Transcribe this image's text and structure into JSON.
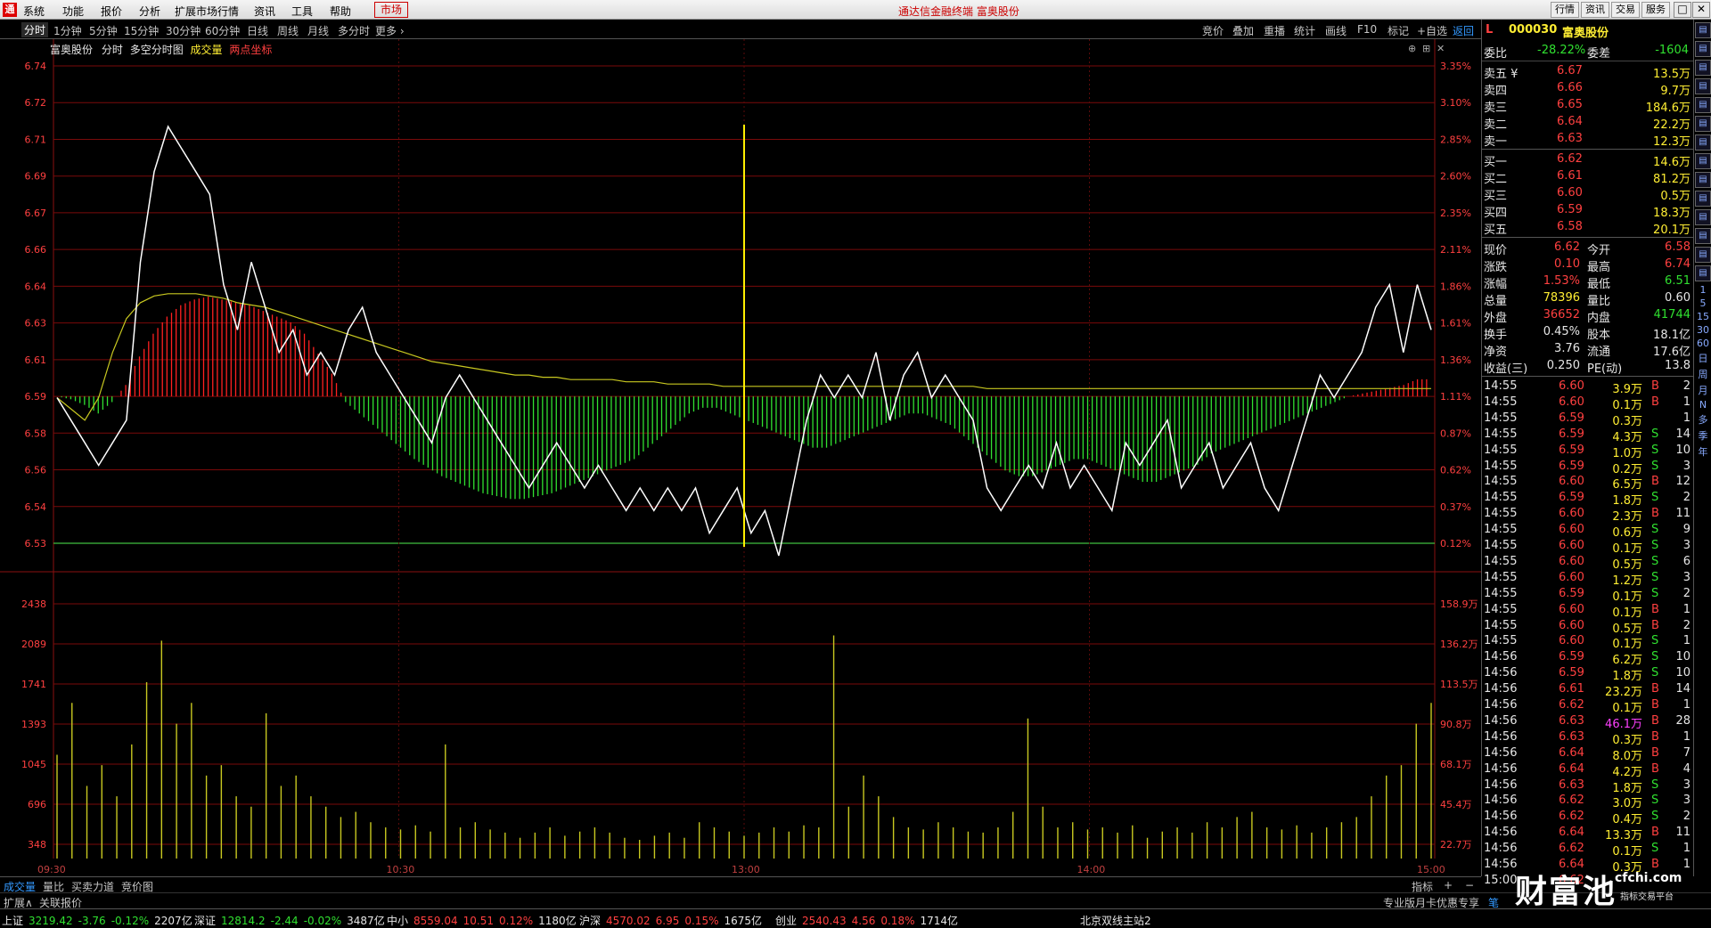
{
  "menubar": {
    "items": [
      "系统",
      "功能",
      "报价",
      "分析",
      "扩展市场行情",
      "资讯",
      "工具",
      "帮助"
    ],
    "market_label": "市场",
    "center_title": "通达信金融终端  富奥股份",
    "right_buttons": [
      "行情",
      "资讯",
      "交易",
      "服务"
    ],
    "win_buttons": [
      "─",
      "□",
      "✕"
    ]
  },
  "periods": {
    "items": [
      "分时",
      "1分钟",
      "5分钟",
      "15分钟",
      "30分钟",
      "60分钟",
      "日线",
      "周线",
      "月线",
      "多分时",
      "更多 ›"
    ],
    "active": "分时"
  },
  "toolbar": {
    "items": [
      "竞价",
      "叠加",
      "重播",
      "统计",
      "画线",
      "F10",
      "标记",
      "+自选"
    ],
    "back": "返回"
  },
  "chart_header": {
    "stock": "富奥股份",
    "items": [
      "分时",
      "多空分时图"
    ],
    "vol_label": "成交量",
    "two_point": "两点坐标"
  },
  "chart_data": {
    "type": "line",
    "price_axis": {
      "min": 6.52,
      "max": 6.74,
      "ticks": [
        6.74,
        6.72,
        6.71,
        6.69,
        6.67,
        6.66,
        6.64,
        6.63,
        6.61,
        6.59,
        6.58,
        6.56,
        6.54,
        6.53
      ],
      "labels": [
        "6.74",
        "6.72",
        "6.71",
        "6.69",
        "6.67",
        "6.66",
        "6.64",
        "6.63",
        "6.61",
        "6.59",
        "6.58",
        "6.56",
        "6.54",
        "6.53"
      ]
    },
    "pct_axis": {
      "labels": [
        "3.35%",
        "3.10%",
        "2.85%",
        "2.60%",
        "2.35%",
        "2.11%",
        "1.86%",
        "1.61%",
        "1.36%",
        "1.11%",
        "0.87%",
        "0.62%",
        "0.37%",
        "0.12%"
      ]
    },
    "volume_axis": {
      "labels": [
        "2438",
        "2089",
        "1741",
        "1393",
        "1045",
        "696",
        "348"
      ],
      "right_labels": [
        "158.9万",
        "136.2万",
        "113.5万",
        "90.8万",
        "68.1万",
        "45.4万",
        "22.7万"
      ]
    },
    "time_labels": [
      "09:30",
      "10:30",
      "13:00",
      "14:00",
      "15:00"
    ],
    "prev_close": 6.52,
    "price": [
      6.59,
      6.58,
      6.57,
      6.56,
      6.57,
      6.58,
      6.65,
      6.69,
      6.71,
      6.7,
      6.69,
      6.68,
      6.64,
      6.62,
      6.65,
      6.63,
      6.61,
      6.62,
      6.6,
      6.61,
      6.6,
      6.62,
      6.63,
      6.61,
      6.6,
      6.59,
      6.58,
      6.57,
      6.59,
      6.6,
      6.59,
      6.58,
      6.57,
      6.56,
      6.55,
      6.56,
      6.57,
      6.56,
      6.55,
      6.56,
      6.55,
      6.54,
      6.55,
      6.54,
      6.55,
      6.54,
      6.55,
      6.53,
      6.54,
      6.55,
      6.53,
      6.54,
      6.52,
      6.55,
      6.58,
      6.6,
      6.59,
      6.6,
      6.59,
      6.61,
      6.58,
      6.6,
      6.61,
      6.59,
      6.6,
      6.59,
      6.58,
      6.55,
      6.54,
      6.55,
      6.56,
      6.55,
      6.57,
      6.55,
      6.56,
      6.55,
      6.54,
      6.57,
      6.56,
      6.57,
      6.58,
      6.55,
      6.56,
      6.57,
      6.55,
      6.56,
      6.57,
      6.55,
      6.54,
      6.56,
      6.58,
      6.6,
      6.59,
      6.6,
      6.61,
      6.63,
      6.64,
      6.61,
      6.64,
      6.62
    ],
    "avg": [
      6.59,
      6.585,
      6.58,
      6.59,
      6.61,
      6.625,
      6.632,
      6.635,
      6.636,
      6.636,
      6.636,
      6.635,
      6.634,
      6.632,
      6.631,
      6.63,
      6.628,
      6.626,
      6.624,
      6.622,
      6.62,
      6.618,
      6.616,
      6.614,
      6.612,
      6.61,
      6.608,
      6.606,
      6.605,
      6.604,
      6.603,
      6.602,
      6.601,
      6.6,
      6.6,
      6.599,
      6.599,
      6.598,
      6.598,
      6.598,
      6.598,
      6.597,
      6.597,
      6.597,
      6.596,
      6.596,
      6.596,
      6.596,
      6.595,
      6.595,
      6.595,
      6.595,
      6.595,
      6.595,
      6.595,
      6.595,
      6.595,
      6.595,
      6.595,
      6.595,
      6.595,
      6.595,
      6.595,
      6.595,
      6.595,
      6.595,
      6.595,
      6.594,
      6.594,
      6.594,
      6.594,
      6.594,
      6.594,
      6.594,
      6.594,
      6.594,
      6.594,
      6.594,
      6.594,
      6.594,
      6.594,
      6.594,
      6.594,
      6.594,
      6.594,
      6.594,
      6.594,
      6.594,
      6.594,
      6.594,
      6.594,
      6.594,
      6.594,
      6.594,
      6.594,
      6.594,
      6.594,
      6.594,
      6.594,
      6.594
    ],
    "sentiment": [
      0,
      -1,
      -3,
      -6,
      -2,
      4,
      14,
      22,
      28,
      32,
      34,
      35,
      34,
      33,
      32,
      30,
      28,
      26,
      22,
      15,
      8,
      -2,
      -6,
      -10,
      -14,
      -18,
      -22,
      -25,
      -28,
      -30,
      -32,
      -34,
      -35,
      -36,
      -36,
      -35,
      -34,
      -32,
      -30,
      -28,
      -26,
      -24,
      -22,
      -18,
      -14,
      -10,
      -6,
      -4,
      -4,
      -6,
      -8,
      -10,
      -12,
      -14,
      -16,
      -18,
      -18,
      -16,
      -14,
      -12,
      -10,
      -8,
      -6,
      -6,
      -8,
      -10,
      -14,
      -18,
      -22,
      -26,
      -28,
      -28,
      -26,
      -24,
      -22,
      -22,
      -24,
      -26,
      -28,
      -30,
      -30,
      -28,
      -26,
      -24,
      -20,
      -18,
      -16,
      -14,
      -12,
      -10,
      -8,
      -6,
      -4,
      -2,
      0,
      1,
      2,
      3,
      4,
      6
    ],
    "volume": [
      1000,
      1500,
      700,
      900,
      600,
      1100,
      1700,
      2100,
      1300,
      1500,
      800,
      900,
      600,
      500,
      1400,
      700,
      800,
      600,
      500,
      400,
      450,
      350,
      300,
      280,
      320,
      260,
      1100,
      300,
      350,
      280,
      250,
      200,
      250,
      300,
      220,
      260,
      300,
      250,
      200,
      180,
      220,
      250,
      200,
      350,
      300,
      260,
      220,
      250,
      300,
      260,
      320,
      300,
      2150,
      500,
      800,
      600,
      400,
      300,
      280,
      350,
      300,
      260,
      250,
      300,
      450,
      1350,
      500,
      300,
      350,
      280,
      300,
      250,
      320,
      200,
      260,
      300,
      250,
      350,
      300,
      400,
      450,
      300,
      280,
      320,
      250,
      300,
      350,
      400,
      600,
      800,
      900,
      1300,
      1500
    ]
  },
  "quote": {
    "code": "000030",
    "name": "富奥股份",
    "weibi_label": "委比",
    "weibi": "-28.22%",
    "weicha_label": "委差",
    "weicha": "-1604",
    "asks": [
      {
        "label": "卖五 ¥",
        "price": "6.67",
        "vol": "13.5万"
      },
      {
        "label": "卖四",
        "price": "6.66",
        "vol": "9.7万"
      },
      {
        "label": "卖三",
        "price": "6.65",
        "vol": "184.6万"
      },
      {
        "label": "卖二",
        "price": "6.64",
        "vol": "22.2万"
      },
      {
        "label": "卖一",
        "price": "6.63",
        "vol": "12.3万"
      }
    ],
    "bids": [
      {
        "label": "买一",
        "price": "6.62",
        "vol": "14.6万"
      },
      {
        "label": "买二",
        "price": "6.61",
        "vol": "81.2万"
      },
      {
        "label": "买三",
        "price": "6.60",
        "vol": "0.5万"
      },
      {
        "label": "买四",
        "price": "6.59",
        "vol": "18.3万"
      },
      {
        "label": "买五",
        "price": "6.58",
        "vol": "20.1万"
      }
    ],
    "stats": [
      {
        "l1": "现价",
        "v1": "6.62",
        "l2": "今开",
        "v2": "6.58"
      },
      {
        "l1": "涨跌",
        "v1": "0.10",
        "l2": "最高",
        "v2": "6.74"
      },
      {
        "l1": "涨幅",
        "v1": "1.53%",
        "l2": "最低",
        "v2": "6.51"
      },
      {
        "l1": "总量",
        "v1": "78396",
        "l2": "量比",
        "v2": "0.60"
      },
      {
        "l1": "外盘",
        "v1": "36652",
        "l2": "内盘",
        "v2": "41744"
      },
      {
        "l1": "换手",
        "v1": "0.45%",
        "l2": "股本",
        "v2": "18.1亿"
      },
      {
        "l1": "净资",
        "v1": "3.76",
        "l2": "流通",
        "v2": "17.6亿"
      },
      {
        "l1": "收益(三)",
        "v1": "0.250",
        "l2": "PE(动)",
        "v2": "13.8"
      }
    ]
  },
  "ticks": [
    {
      "t": "14:55",
      "p": "6.60",
      "v": "3.9万",
      "bs": "B",
      "n": "2"
    },
    {
      "t": "14:55",
      "p": "6.60",
      "v": "0.1万",
      "bs": "B",
      "n": "1"
    },
    {
      "t": "14:55",
      "p": "6.59",
      "v": "0.3万",
      "bs": "",
      "n": "1"
    },
    {
      "t": "14:55",
      "p": "6.59",
      "v": "4.3万",
      "bs": "S",
      "n": "14"
    },
    {
      "t": "14:55",
      "p": "6.59",
      "v": "1.0万",
      "bs": "S",
      "n": "10"
    },
    {
      "t": "14:55",
      "p": "6.59",
      "v": "0.2万",
      "bs": "S",
      "n": "3"
    },
    {
      "t": "14:55",
      "p": "6.60",
      "v": "6.5万",
      "bs": "B",
      "n": "12"
    },
    {
      "t": "14:55",
      "p": "6.59",
      "v": "1.8万",
      "bs": "S",
      "n": "2"
    },
    {
      "t": "14:55",
      "p": "6.60",
      "v": "2.3万",
      "bs": "B",
      "n": "11"
    },
    {
      "t": "14:55",
      "p": "6.60",
      "v": "0.6万",
      "bs": "S",
      "n": "9"
    },
    {
      "t": "14:55",
      "p": "6.60",
      "v": "0.1万",
      "bs": "S",
      "n": "3"
    },
    {
      "t": "14:55",
      "p": "6.60",
      "v": "0.5万",
      "bs": "S",
      "n": "6"
    },
    {
      "t": "14:55",
      "p": "6.60",
      "v": "1.2万",
      "bs": "S",
      "n": "3"
    },
    {
      "t": "14:55",
      "p": "6.59",
      "v": "0.1万",
      "bs": "S",
      "n": "2"
    },
    {
      "t": "14:55",
      "p": "6.60",
      "v": "0.1万",
      "bs": "B",
      "n": "1"
    },
    {
      "t": "14:55",
      "p": "6.60",
      "v": "0.5万",
      "bs": "B",
      "n": "2"
    },
    {
      "t": "14:55",
      "p": "6.60",
      "v": "0.1万",
      "bs": "S",
      "n": "1"
    },
    {
      "t": "14:56",
      "p": "6.59",
      "v": "6.2万",
      "bs": "S",
      "n": "10"
    },
    {
      "t": "14:56",
      "p": "6.59",
      "v": "1.8万",
      "bs": "S",
      "n": "10"
    },
    {
      "t": "14:56",
      "p": "6.61",
      "v": "23.2万",
      "bs": "B",
      "n": "14"
    },
    {
      "t": "14:56",
      "p": "6.62",
      "v": "0.1万",
      "bs": "B",
      "n": "1"
    },
    {
      "t": "14:56",
      "p": "6.63",
      "v": "46.1万",
      "bs": "B",
      "n": "28"
    },
    {
      "t": "14:56",
      "p": "6.63",
      "v": "0.3万",
      "bs": "B",
      "n": "1"
    },
    {
      "t": "14:56",
      "p": "6.64",
      "v": "8.0万",
      "bs": "B",
      "n": "7"
    },
    {
      "t": "14:56",
      "p": "6.64",
      "v": "4.2万",
      "bs": "B",
      "n": "4"
    },
    {
      "t": "14:56",
      "p": "6.63",
      "v": "1.8万",
      "bs": "S",
      "n": "3"
    },
    {
      "t": "14:56",
      "p": "6.62",
      "v": "3.0万",
      "bs": "S",
      "n": "3"
    },
    {
      "t": "14:56",
      "p": "6.62",
      "v": "0.4万",
      "bs": "S",
      "n": "2"
    },
    {
      "t": "14:56",
      "p": "6.64",
      "v": "13.3万",
      "bs": "B",
      "n": "11"
    },
    {
      "t": "14:56",
      "p": "6.62",
      "v": "0.1万",
      "bs": "S",
      "n": "1"
    },
    {
      "t": "14:56",
      "p": "6.64",
      "v": "0.3万",
      "bs": "B",
      "n": "1"
    },
    {
      "t": "15:00",
      "p": "6.62",
      "v": "",
      "bs": "",
      "n": ""
    }
  ],
  "bottom_tabs": {
    "items": [
      "成交量",
      "量比",
      "买卖力道",
      "竞价图"
    ],
    "active": "成交量",
    "right": [
      "指标",
      "+",
      "−"
    ]
  },
  "bottom2": {
    "items": [
      "扩展∧",
      "关联报价"
    ],
    "promo": "专业版月卡优惠专享",
    "right": "笔"
  },
  "status": {
    "items": [
      {
        "name": "上证",
        "val": "3219.42",
        "chg": "-3.76",
        "pct": "-0.12%",
        "amt": "2207亿",
        "dir": "down"
      },
      {
        "name": "深证",
        "val": "12814.2",
        "chg": "-2.44",
        "pct": "-0.02%",
        "amt": "3487亿",
        "dir": "down"
      },
      {
        "name": "中小",
        "val": "8559.04",
        "chg": "10.51",
        "pct": "0.12%",
        "amt": "1180亿",
        "dir": "up"
      },
      {
        "name": "沪深",
        "val": "4570.02",
        "chg": "6.95",
        "pct": "0.15%",
        "amt": "1675亿",
        "dir": "up"
      },
      {
        "name": "创业",
        "val": "2540.43",
        "chg": "4.56",
        "pct": "0.18%",
        "amt": "1714亿",
        "dir": "up"
      }
    ],
    "server": "北京双线主站2"
  },
  "watermark": {
    "big": "财富池",
    "url": "cfchi.com",
    "sub": "指标交易平台"
  },
  "sidebar": {
    "labels": [
      "1",
      "5",
      "15",
      "30",
      "60",
      "日",
      "周",
      "月",
      "N",
      "多",
      "季",
      "年"
    ]
  }
}
